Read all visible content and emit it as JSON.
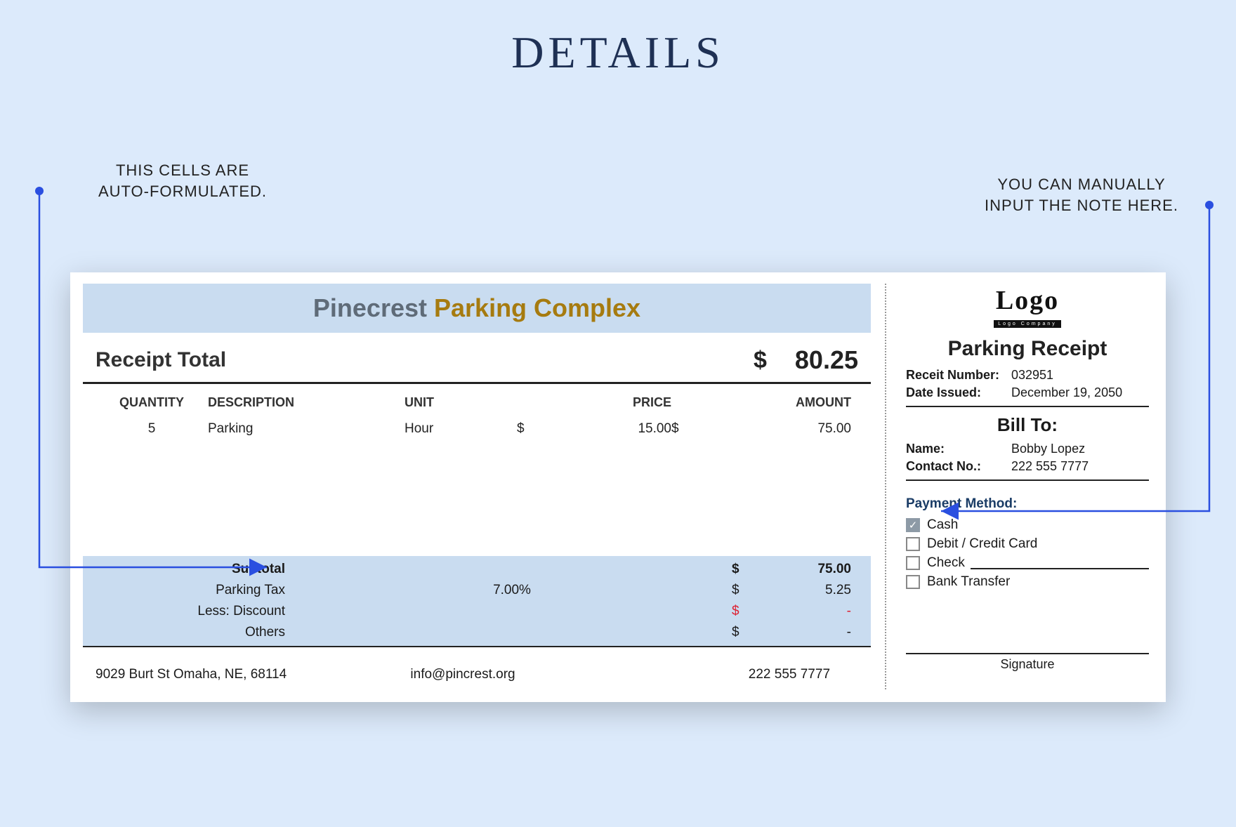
{
  "page_title": "DETAILS",
  "annotations": {
    "left": "THIS CELLS ARE\nAUTO-FORMULATED.",
    "right": "YOU CAN MANUALLY\nINPUT THE NOTE HERE."
  },
  "company": {
    "part1": "Pinecrest ",
    "part2": "Parking Complex"
  },
  "receipt_total": {
    "label": "Receipt Total",
    "currency": "$",
    "amount": "80.25"
  },
  "columns": {
    "qty": "QUANTITY",
    "desc": "DESCRIPTION",
    "unit": "UNIT",
    "price": "PRICE",
    "amount": "AMOUNT"
  },
  "rows": [
    {
      "qty": "5",
      "desc": "Parking",
      "unit": "Hour",
      "price_sym": "$",
      "price": "15.00",
      "amount_sym": "$",
      "amount": "75.00"
    }
  ],
  "summary": {
    "subtotal": {
      "label": "Subtotal",
      "sym": "$",
      "value": "75.00"
    },
    "tax": {
      "label": "Parking Tax",
      "rate": "7.00%",
      "sym": "$",
      "value": "5.25"
    },
    "discount": {
      "label": "Less: Discount",
      "sym": "$",
      "value": "-"
    },
    "others": {
      "label": "Others",
      "sym": "$",
      "value": "-"
    }
  },
  "footer": {
    "address": "9029 Burt St Omaha, NE, 68114",
    "email": "info@pincrest.org",
    "phone": "222 555 7777"
  },
  "right": {
    "logo_main": "Logo",
    "logo_sub": "Logo Company",
    "title": "Parking Receipt",
    "receipt_no_label": "Receit Number:",
    "receipt_no": "032951",
    "date_label": "Date Issued:",
    "date": "December 19, 2050",
    "billto": "Bill To:",
    "name_label": "Name:",
    "name": "Bobby Lopez",
    "contact_label": "Contact No.:",
    "contact": "222 555 7777",
    "payment_title": "Payment Method:",
    "methods": [
      {
        "label": "Cash",
        "checked": true
      },
      {
        "label": "Debit / Credit Card",
        "checked": false
      },
      {
        "label": "Check",
        "checked": false,
        "has_line": true
      },
      {
        "label": "Bank Transfer",
        "checked": false
      }
    ],
    "signature": "Signature"
  }
}
